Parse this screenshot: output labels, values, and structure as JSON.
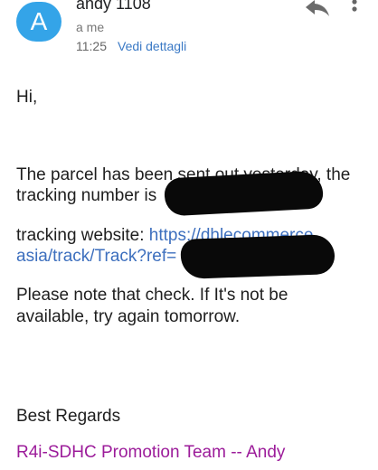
{
  "header": {
    "avatar_letter": "A",
    "sender": "andy 1108",
    "recipient": "a me",
    "time": "11:25",
    "details_link": "Vedi dettagli",
    "reply_icon": "reply-icon",
    "more_icon": "more-vert-icon"
  },
  "message": {
    "greeting": "Hi,",
    "line1": "The parcel has been sent out yesterday, the",
    "line2": "tracking number is",
    "tracking_label": "tracking website: ",
    "tracking_url_1": "https://dhlecommerce.",
    "tracking_url_2": "asia/track/Track?ref=",
    "note_1": "Please note that check. If It's not be",
    "note_2": "available, try again tomorrow.",
    "closing": "Best Regards",
    "signature": "R4i-SDHC Promotion Team -- Andy"
  },
  "colors": {
    "accent": "#34a4e8",
    "link": "#3d6fbe",
    "signature": "#9c1c9a"
  }
}
